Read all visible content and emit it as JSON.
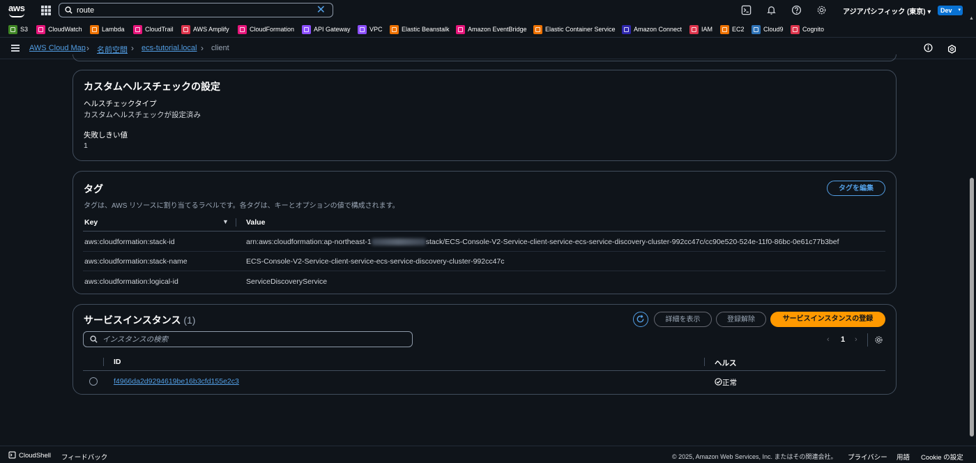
{
  "search": {
    "value": "route"
  },
  "header": {
    "region": "アジアパシフィック (東京) ▾",
    "account_badge": "Dev"
  },
  "favorites": [
    {
      "label": "S3",
      "color": "#3f8624"
    },
    {
      "label": "CloudWatch",
      "color": "#e7157b"
    },
    {
      "label": "Lambda",
      "color": "#ed7100"
    },
    {
      "label": "CloudTrail",
      "color": "#e7157b"
    },
    {
      "label": "AWS Amplify",
      "color": "#dd344c"
    },
    {
      "label": "CloudFormation",
      "color": "#e7157b"
    },
    {
      "label": "API Gateway",
      "color": "#8c4fff"
    },
    {
      "label": "VPC",
      "color": "#8c4fff"
    },
    {
      "label": "Elastic Beanstalk",
      "color": "#ed7100"
    },
    {
      "label": "Amazon EventBridge",
      "color": "#e7157b"
    },
    {
      "label": "Elastic Container Service",
      "color": "#ed7100"
    },
    {
      "label": "Amazon Connect",
      "color": "#2e27ad"
    },
    {
      "label": "IAM",
      "color": "#dd344c"
    },
    {
      "label": "EC2",
      "color": "#ed7100"
    },
    {
      "label": "Cloud9",
      "color": "#2e73b8"
    },
    {
      "label": "Cognito",
      "color": "#dd344c"
    }
  ],
  "breadcrumb": {
    "items": [
      "AWS Cloud Map",
      "名前空間",
      "ecs-tutorial.local"
    ],
    "current": "client"
  },
  "healthcheck": {
    "title": "カスタムヘルスチェックの設定",
    "type_label": "ヘルスチェックタイプ",
    "type_value": "カスタムヘルスチェックが設定済み",
    "threshold_label": "失敗しきい値",
    "threshold_value": "1"
  },
  "tags": {
    "title": "タグ",
    "description": "タグは、AWS リソースに割り当てるラベルです。各タグは、キーとオプションの値で構成されます。",
    "edit_button": "タグを編集",
    "columns": [
      "Key",
      "Value"
    ],
    "rows": [
      {
        "key": "aws:cloudformation:stack-id",
        "value_prefix": "arn:aws:cloudformation:ap-northeast-1",
        "value_suffix": "stack/ECS-Console-V2-Service-client-service-ecs-service-discovery-cluster-992cc47c/cc90e520-524e-11f0-86bc-0e61c77b3bef"
      },
      {
        "key": "aws:cloudformation:stack-name",
        "value": "ECS-Console-V2-Service-client-service-ecs-service-discovery-cluster-992cc47c"
      },
      {
        "key": "aws:cloudformation:logical-id",
        "value": "ServiceDiscoveryService"
      }
    ]
  },
  "instances": {
    "title": "サービスインスタンス",
    "count": "(1)",
    "details_button": "詳細を表示",
    "deregister_button": "登録解除",
    "register_button": "サービスインスタンスの登録",
    "search_placeholder": "インスタンスの検索",
    "page": "1",
    "columns": [
      "ID",
      "ヘルス"
    ],
    "rows": [
      {
        "id": "f4966da2d9294619be16b3cfd155e2c3",
        "health": "正常"
      }
    ]
  },
  "footer": {
    "cloudshell": "CloudShell",
    "feedback": "フィードバック",
    "copyright": "© 2025, Amazon Web Services, Inc. またはその関連会社。",
    "privacy": "プライバシー",
    "terms": "用語",
    "cookie": "Cookie の設定"
  },
  "colors": {
    "background": "#0f141a",
    "link": "#539fe5",
    "primary_button": "#ff9900",
    "border": "#414d5c",
    "success": "#ffffff"
  }
}
